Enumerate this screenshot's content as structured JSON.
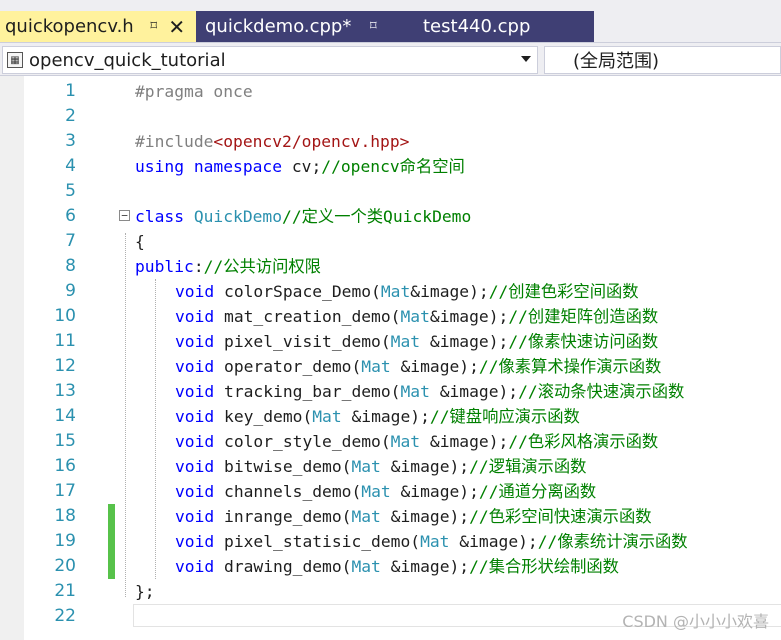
{
  "tabs": [
    {
      "label": "quickopencv.h",
      "pin": "⌑",
      "close": "✕",
      "active": true
    },
    {
      "label": "quickdemo.cpp*",
      "pin": "⌑",
      "active": false
    },
    {
      "label": "test440.cpp",
      "active": false
    }
  ],
  "navbar": {
    "scope": "opencv_quick_tutorial",
    "member": "(全局范围)"
  },
  "icons": {
    "tab_pin": "pin-icon",
    "tab_close": "close-icon",
    "scope": "project-icon",
    "dropdown": "chevron-down-icon",
    "fold": "collapse-icon"
  },
  "colors": {
    "tab_active": "#fff29d",
    "tab_inactive": "#3f3f74",
    "keyword": "#0000ff",
    "type": "#2b91af",
    "comment": "#008000",
    "string": "#a31515",
    "preprocessor": "#808080",
    "line_number": "#2b91af",
    "change_marker": "#57c24a"
  },
  "code": {
    "line_numbers": [
      "1",
      "2",
      "3",
      "4",
      "5",
      "6",
      "7",
      "8",
      "9",
      "10",
      "11",
      "12",
      "13",
      "14",
      "15",
      "16",
      "17",
      "18",
      "19",
      "20",
      "21",
      "22"
    ],
    "l1_pp": "#pragma once",
    "l3_pp": "#include",
    "l3_str": "<opencv2/opencv.hpp>",
    "l4_kw": "using namespace",
    "l4_txt": " cv;",
    "l4_cm": "//opencv命名空间",
    "l6_kw": "class",
    "l6_ty": " QuickDemo",
    "l6_cm": "//定义一个类QuickDemo",
    "l7_txt": "{",
    "l8_kw": "public",
    "l8_txt": ":",
    "l8_cm": "//公共访问权限",
    "methods": [
      {
        "kw": "void",
        "name": " colorSpace_Demo(",
        "ty": "Mat",
        "param": "&image);",
        "cm": "//创建色彩空间函数"
      },
      {
        "kw": "void",
        "name": " mat_creation_demo(",
        "ty": "Mat",
        "param": "&image);",
        "cm": "//创建矩阵创造函数"
      },
      {
        "kw": "void",
        "name": " pixel_visit_demo(",
        "ty": "Mat",
        "param": " &image);",
        "cm": "//像素快速访问函数"
      },
      {
        "kw": "void",
        "name": " operator_demo(",
        "ty": "Mat",
        "param": " &image);",
        "cm": "//像素算术操作演示函数"
      },
      {
        "kw": "void",
        "name": " tracking_bar_demo(",
        "ty": "Mat",
        "param": " &image);",
        "cm": "//滚动条快速演示函数"
      },
      {
        "kw": "void",
        "name": " key_demo(",
        "ty": "Mat",
        "param": " &image);",
        "cm": "//键盘响应演示函数"
      },
      {
        "kw": "void",
        "name": " color_style_demo(",
        "ty": "Mat",
        "param": " &image);",
        "cm": "//色彩风格演示函数"
      },
      {
        "kw": "void",
        "name": " bitwise_demo(",
        "ty": "Mat",
        "param": " &image);",
        "cm": "//逻辑演示函数"
      },
      {
        "kw": "void",
        "name": " channels_demo(",
        "ty": "Mat",
        "param": " &image);",
        "cm": "//通道分离函数"
      },
      {
        "kw": "void",
        "name": " inrange_demo(",
        "ty": "Mat",
        "param": " &image);",
        "cm": "//色彩空间快速演示函数"
      },
      {
        "kw": "void",
        "name": " pixel_statisic_demo(",
        "ty": "Mat",
        "param": " &image);",
        "cm": "//像素统计演示函数"
      },
      {
        "kw": "void",
        "name": " drawing_demo(",
        "ty": "Mat",
        "param": " &image);",
        "cm": "//集合形状绘制函数"
      }
    ],
    "l21_txt": "};"
  },
  "watermark": "CSDN @小小小欢喜"
}
